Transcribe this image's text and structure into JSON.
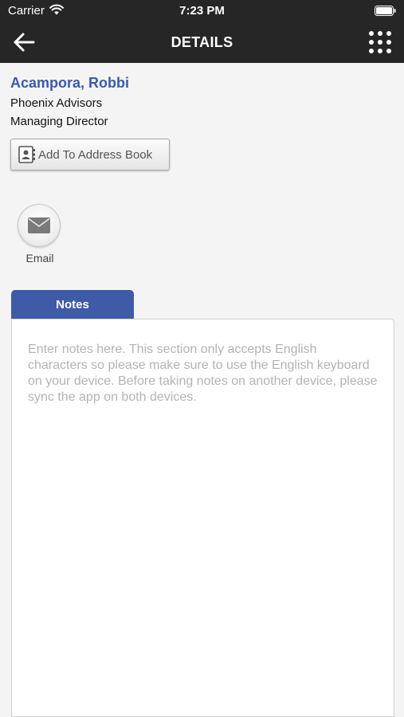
{
  "status_bar": {
    "carrier": "Carrier",
    "time": "7:23 PM",
    "icons": [
      "wifi-icon",
      "battery-icon"
    ]
  },
  "nav": {
    "title": "DETAILS",
    "back_icon": "arrow-left-icon",
    "menu_icon": "grid-menu-icon"
  },
  "contact": {
    "name": "Acampora, Robbi",
    "company": "Phoenix Advisors",
    "title": "Managing Director"
  },
  "actions": {
    "add_to_address_book": "Add To Address Book",
    "email_label": "Email"
  },
  "notes": {
    "tab_label": "Notes",
    "placeholder": "Enter notes here. This section only accepts English characters so please make sure to use the English keyboard on your device. Before taking notes on another device, please sync the app on both devices.",
    "value": ""
  },
  "colors": {
    "topbar": "#262626",
    "accent": "#3f5aa6",
    "name_text": "#3a5aa8",
    "background": "#f4f4f4"
  }
}
